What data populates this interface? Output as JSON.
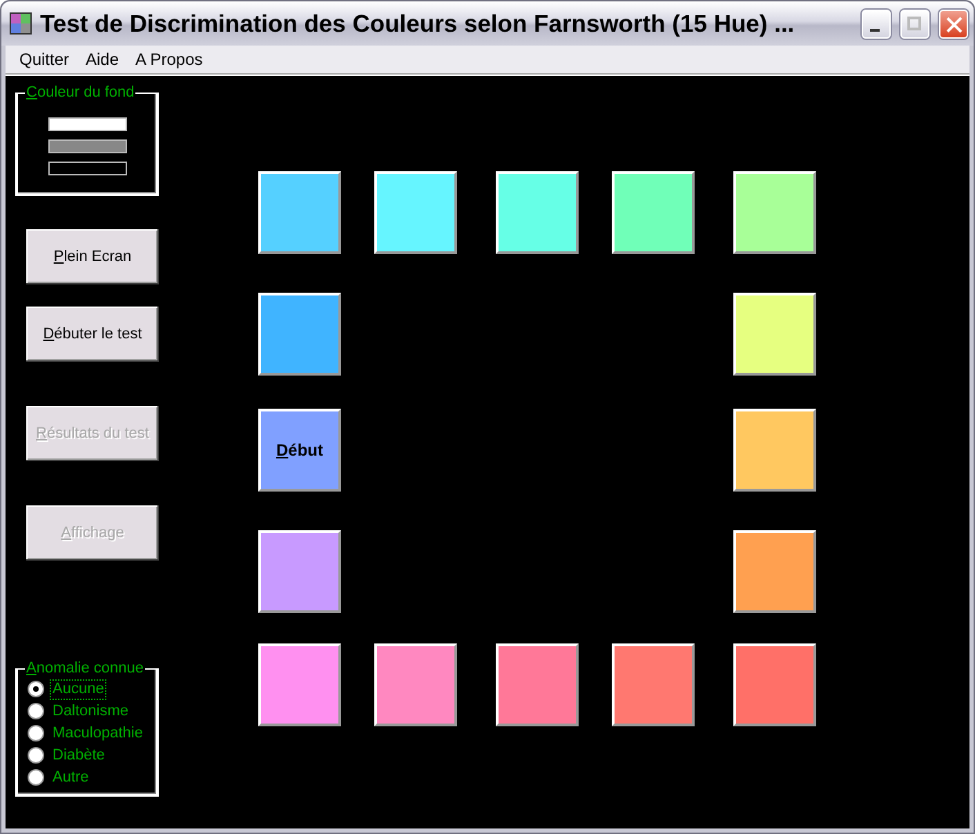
{
  "window": {
    "title": "Test de Discrimination des Couleurs selon Farnsworth (15 Hue) ..."
  },
  "menu": [
    "Quitter",
    "Aide",
    "A Propos"
  ],
  "background_panel": {
    "legend": "Couleur du fond",
    "options": [
      {
        "color": "#ffffff"
      },
      {
        "color": "#888888"
      },
      {
        "color": "#000000"
      }
    ]
  },
  "buttons": [
    {
      "label": "Plein Ecran",
      "disabled": false
    },
    {
      "label": "Débuter le test",
      "disabled": false
    },
    {
      "label": "Résultats du test",
      "disabled": true
    },
    {
      "label": "Affichage",
      "disabled": true
    }
  ],
  "anomaly_panel": {
    "legend": "Anomalie connue",
    "options": [
      {
        "label": "Aucune",
        "selected": true
      },
      {
        "label": "Daltonisme",
        "selected": false
      },
      {
        "label": "Maculopathie",
        "selected": false
      },
      {
        "label": "Diabète",
        "selected": false
      },
      {
        "label": "Autre",
        "selected": false
      }
    ]
  },
  "board": {
    "rows": [
      [
        {
          "color": "#55d0ff"
        },
        {
          "color": "#66f5ff"
        },
        {
          "color": "#66ffe6"
        },
        {
          "color": "#70ffb8"
        },
        {
          "color": "#a8ff98"
        }
      ],
      [
        {
          "color": "#40b4ff"
        },
        {
          "color": "#e6ff80"
        }
      ],
      [
        {
          "color": "#80a0ff",
          "label": "Début"
        },
        {
          "color": "#ffc860"
        }
      ],
      [
        {
          "color": "#c89aff"
        },
        {
          "color": "#ffa050"
        }
      ],
      [
        {
          "color": "#ff90f0"
        },
        {
          "color": "#ff88c0"
        },
        {
          "color": "#ff7898"
        },
        {
          "color": "#ff7870"
        },
        {
          "color": "#ff7068"
        }
      ]
    ]
  }
}
